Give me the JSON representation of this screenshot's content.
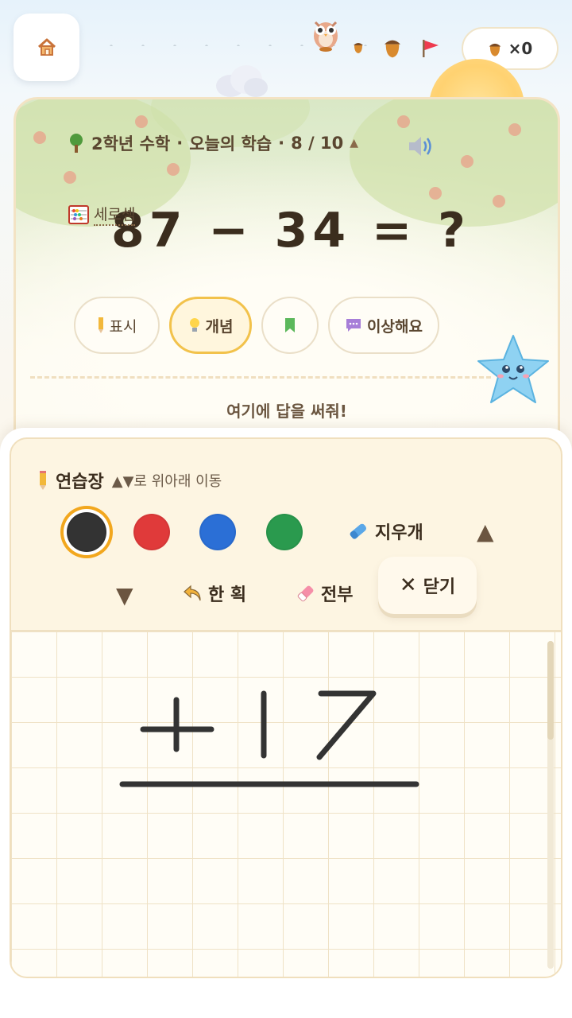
{
  "header": {
    "acorn_count": "×0"
  },
  "question": {
    "breadcrumb_grade": "2학년 수학",
    "breadcrumb_sep": "·",
    "breadcrumb_lesson": "오늘의 학습",
    "breadcrumb_progress": "8 / 10",
    "concept_tag": "세로셈",
    "problem": "87 − 34 = ?",
    "chips": {
      "show_label": "표시",
      "concept_label": "개념",
      "report_label": "이상해요"
    },
    "answer_hint": "여기에 답을 써줘!"
  },
  "pad": {
    "title": "연습장",
    "subtitle": "▲▼로 위아래 이동",
    "colors": [
      "#333333",
      "#e03a3a",
      "#2b6fd6",
      "#2a9a4e"
    ],
    "selected_color": "#333333",
    "eraser_label": "지우개",
    "undo_label": "한 획",
    "clear_label": "전부",
    "close_label": "닫기",
    "up_arrow": "▲",
    "down_arrow": "▼",
    "scroll_position": 0
  }
}
